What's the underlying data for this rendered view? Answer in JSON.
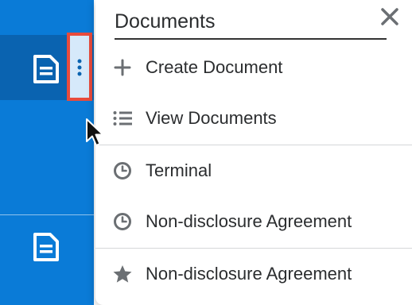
{
  "sidebar": {
    "items": [
      {
        "icon": "document-icon",
        "active": true
      },
      {
        "icon": "document-icon",
        "active": false
      }
    ],
    "actions_button": {
      "icon": "kebab-menu-icon"
    }
  },
  "menu": {
    "title": "Documents",
    "close_icon": "close-icon",
    "actions": [
      {
        "label": "Create Document",
        "icon": "plus-icon"
      },
      {
        "label": "View Documents",
        "icon": "list-icon"
      }
    ],
    "recent": [
      {
        "label": "Terminal",
        "icon": "clock-icon"
      },
      {
        "label": "Non-disclosure Agreement",
        "icon": "clock-icon"
      }
    ],
    "favorites": [
      {
        "label": "Non-disclosure Agreement",
        "icon": "star-icon"
      }
    ]
  },
  "colors": {
    "sidebar": "#0a7bd7",
    "sidebar_active": "#0a63b0",
    "highlight_border": "#e84b3c",
    "icon_gray": "#6b6f73",
    "text": "#2b2d2f"
  }
}
